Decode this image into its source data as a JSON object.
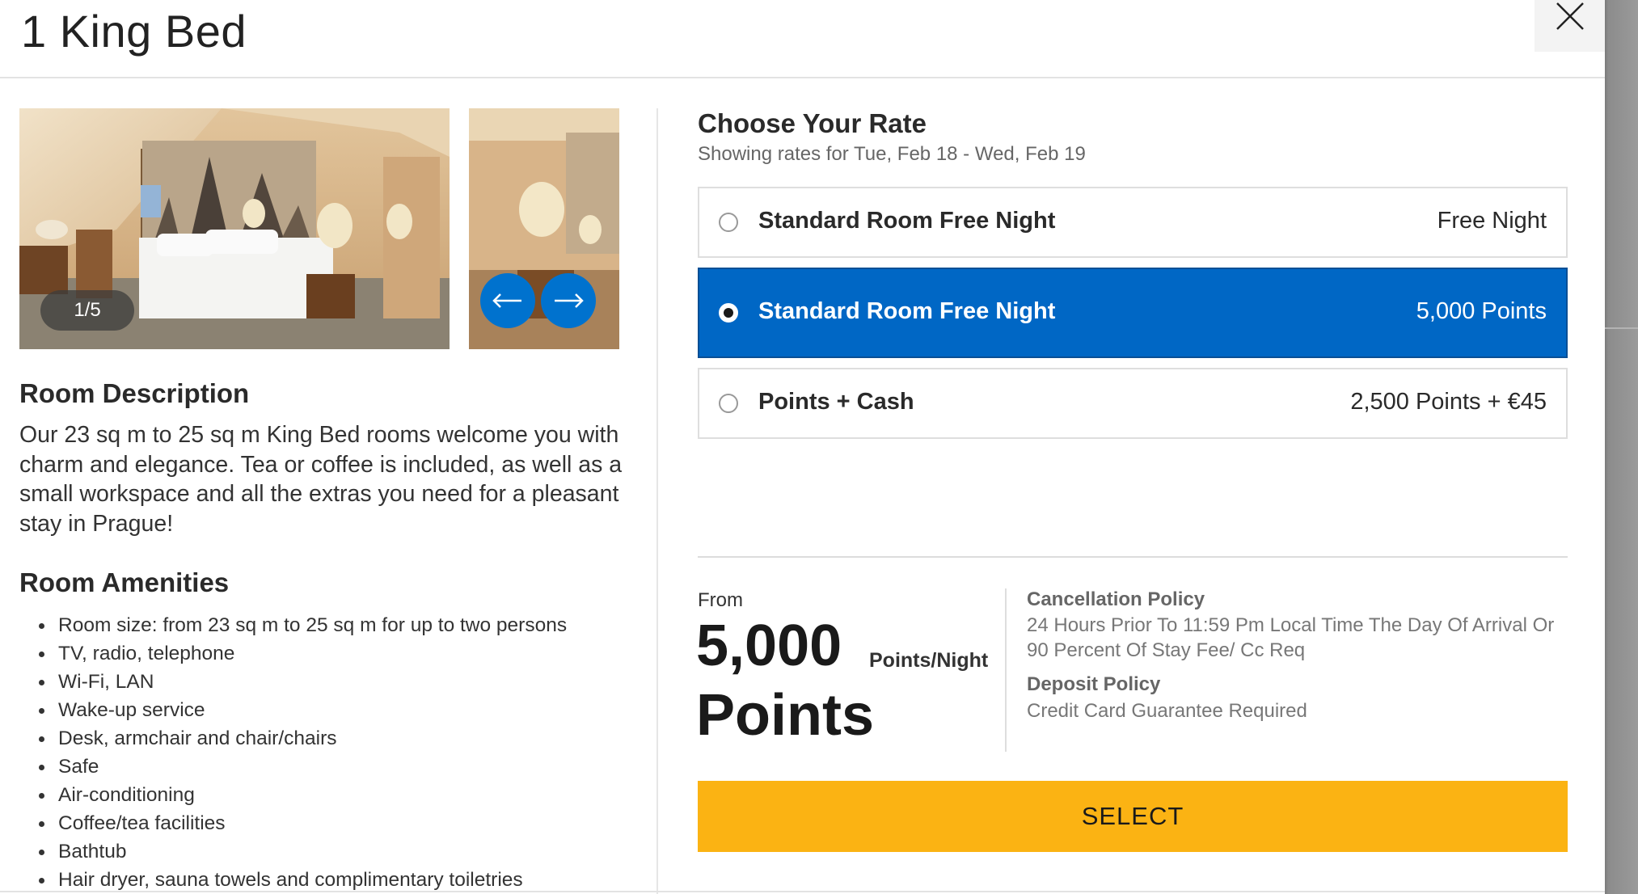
{
  "modal": {
    "title": "1 King Bed"
  },
  "gallery": {
    "counter": "1/5",
    "prev_icon": "arrow-left-icon",
    "next_icon": "arrow-right-icon"
  },
  "room_description": {
    "heading": "Room Description",
    "text": "Our 23 sq m to 25 sq m King Bed rooms welcome you with charm and elegance. Tea or coffee is included, as well as a small workspace and all the extras you need for a pleasant stay in Prague!"
  },
  "amenities": {
    "heading": "Room Amenities",
    "items": [
      "Room size: from 23 sq m to 25 sq m for up to two persons",
      "TV, radio, telephone",
      "Wi-Fi, LAN",
      "Wake-up service",
      "Desk, armchair and chair/chairs",
      "Safe",
      "Air-conditioning",
      "Coffee/tea facilities",
      "Bathtub",
      "Hair dryer, sauna towels and complimentary toiletries"
    ]
  },
  "rates": {
    "heading": "Choose Your Rate",
    "subheading": "Showing rates for Tue, Feb 18 - Wed, Feb 19",
    "options": [
      {
        "name": "Standard Room Free Night",
        "price": "Free Night",
        "selected": false
      },
      {
        "name": "Standard Room Free Night",
        "price": "5,000 Points",
        "selected": true
      },
      {
        "name": "Points + Cash",
        "price": "2,500 Points + €45",
        "selected": false
      }
    ]
  },
  "summary": {
    "from_label": "From",
    "amount": "5,000 Points",
    "unit": "Points/Night"
  },
  "policies": {
    "cancellation_heading": "Cancellation Policy",
    "cancellation_text": "24 Hours Prior To 11:59 Pm Local Time The Day Of Arrival Or 90 Percent Of Stay Fee/ Cc Req",
    "deposit_heading": "Deposit Policy",
    "deposit_text": "Credit Card Guarantee Required"
  },
  "actions": {
    "select_label": "SELECT"
  },
  "colors": {
    "brand_blue": "#0067c5",
    "select_yellow": "#fbb313"
  }
}
